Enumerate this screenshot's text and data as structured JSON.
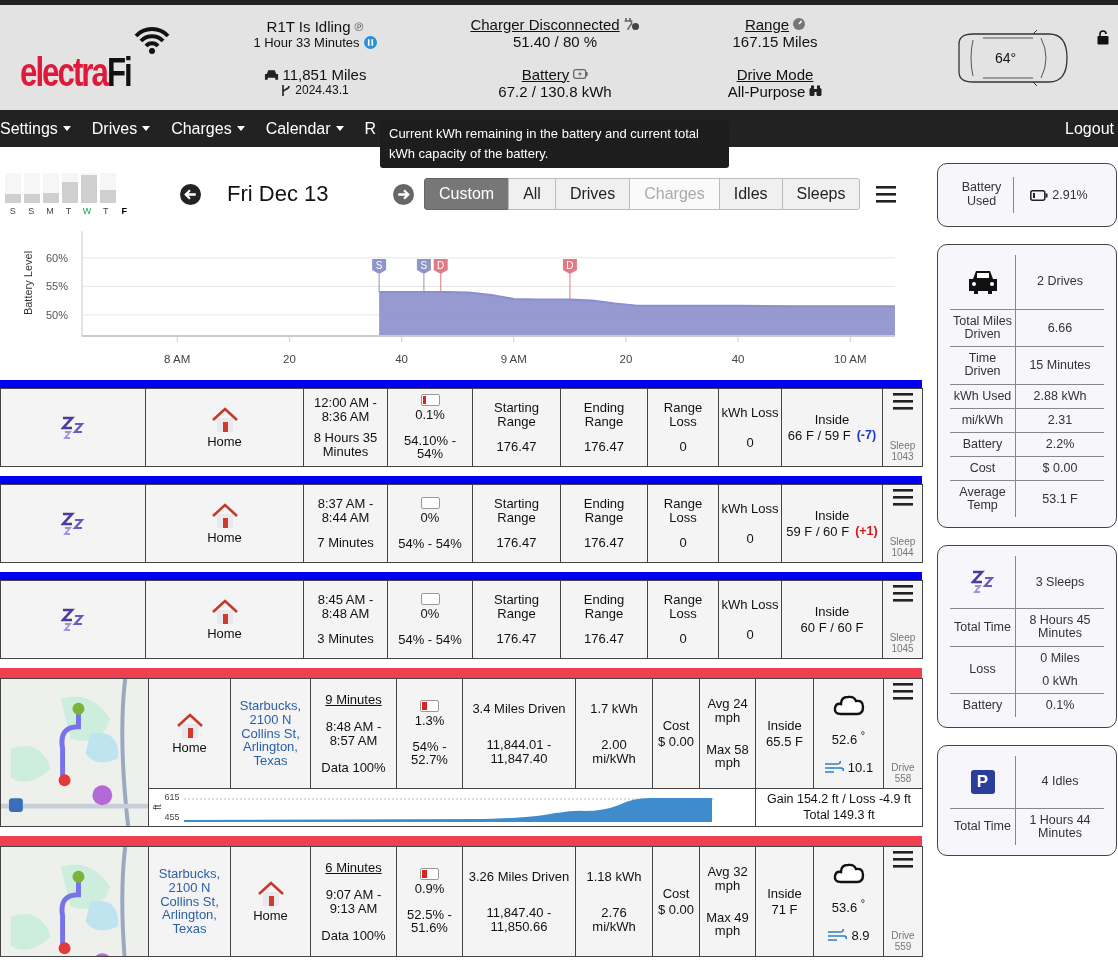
{
  "header": {
    "logo": {
      "main": "electra",
      "accent": "Fi"
    },
    "status": {
      "title": "R1T Is Idling",
      "badge": "℗",
      "duration": "1 Hour 33 Minutes"
    },
    "odometer": "11,851 Miles",
    "version": "2024.43.1",
    "charger": {
      "label": "Charger Disconnected",
      "value": "51.40 / 80 %"
    },
    "battery": {
      "label": "Battery",
      "value": "67.2 / 130.8 kWh"
    },
    "range": {
      "label": "Range",
      "value": "167.15 Miles"
    },
    "drive_mode": {
      "label": "Drive Mode",
      "value": "All-Purpose"
    },
    "cabin_temp": "64°",
    "locked": false
  },
  "nav": {
    "items": [
      "Settings",
      "Drives",
      "Charges",
      "Calendar",
      "R"
    ],
    "logout": "Logout"
  },
  "tooltip": "Current kWh remaining in the battery and current total kWh capacity of the battery.",
  "week": [
    {
      "day": "S",
      "level": 0.27,
      "kind": "past"
    },
    {
      "day": "S",
      "level": 0.3,
      "kind": "past"
    },
    {
      "day": "M",
      "level": 0.33,
      "kind": "past"
    },
    {
      "day": "T",
      "level": 0.67,
      "kind": "past"
    },
    {
      "day": "W",
      "level": 0.93,
      "kind": "highlight"
    },
    {
      "day": "T",
      "level": 0.43,
      "kind": "past"
    },
    {
      "day": "F",
      "kind": "today"
    }
  ],
  "date": "Fri Dec 13",
  "filters": [
    {
      "label": "Custom",
      "selected": true,
      "disabled": false
    },
    {
      "label": "All",
      "selected": false,
      "disabled": false
    },
    {
      "label": "Drives",
      "selected": false,
      "disabled": false
    },
    {
      "label": "Charges",
      "selected": false,
      "disabled": true
    },
    {
      "label": "Idles",
      "selected": false,
      "disabled": false
    },
    {
      "label": "Sleeps",
      "selected": false,
      "disabled": false
    }
  ],
  "chart_data": {
    "type": "area",
    "ylabel": "Battery Level",
    "grid": true,
    "xlim": [
      7.717,
      10.133
    ],
    "ylim": [
      46.3,
      64.7
    ],
    "xticks": [
      {
        "value": 8,
        "label": "8 AM"
      },
      {
        "value": 9,
        "label": "9 AM"
      },
      {
        "value": 10,
        "label": "10 AM"
      }
    ],
    "yticks": [
      {
        "value": 50,
        "label": "50%"
      },
      {
        "value": 55,
        "label": "55%"
      },
      {
        "value": 60,
        "label": "60%"
      }
    ],
    "x": [
      8.6,
      8.733,
      8.8,
      8.867,
      8.933,
      9.0,
      9.067,
      9.167,
      9.233,
      9.3,
      9.367,
      9.5,
      9.667,
      9.833,
      10.133
    ],
    "series": [
      {
        "color": "#8b8fcc",
        "values": [
          54,
          54,
          54,
          53.9,
          53.5,
          52.8,
          52.7,
          52.7,
          52.5,
          52.0,
          51.6,
          51.6,
          51.6,
          51.5,
          51.5
        ]
      }
    ],
    "annotations": [
      {
        "x": 8.6,
        "y": 54,
        "text": "S"
      },
      {
        "x": 8.733,
        "y": 54,
        "text": "S"
      },
      {
        "x": 8.783,
        "y": 54,
        "text": "D"
      },
      {
        "x": 9.167,
        "y": 52.7,
        "text": "D"
      }
    ]
  },
  "minor_xticks": [
    {
      "label": "20"
    },
    {
      "label": "40"
    },
    {
      "label": "20"
    },
    {
      "label": "40"
    }
  ],
  "chart_markers": [
    {
      "kind": "sleep"
    },
    {
      "kind": "sleep"
    },
    {
      "kind": "drive"
    },
    {
      "kind": "drive"
    }
  ],
  "rows": [
    {
      "kind": "sleep",
      "place": "Home",
      "time_range": "12:00 AM - 8:36 AM",
      "duration": "8 Hours 35 Minutes",
      "battery": {
        "used": "0.1%",
        "level": 0.25,
        "range": "54.10% - 54%"
      },
      "stats": [
        {
          "label": "Starting Range",
          "value": "176.47"
        },
        {
          "label": "Ending Range",
          "value": "176.47"
        },
        {
          "label": "Range Loss",
          "value": "0"
        },
        {
          "label": "kWh Loss",
          "value": "0"
        }
      ],
      "inside_label": "Inside",
      "inside": "66 F / 59 F",
      "delta": {
        "text": "(-7)",
        "color": "#1d3ac2"
      },
      "ref": "Sleep 1043"
    },
    {
      "kind": "sleep",
      "place": "Home",
      "time_range": "8:37 AM - 8:44 AM",
      "duration": "7 Minutes",
      "battery": {
        "used": "0%",
        "range": "54% - 54%"
      },
      "stats": [
        {
          "label": "Starting Range",
          "value": "176.47"
        },
        {
          "label": "Ending Range",
          "value": "176.47"
        },
        {
          "label": "Range Loss",
          "value": "0"
        },
        {
          "label": "kWh Loss",
          "value": "0"
        }
      ],
      "inside_label": "Inside",
      "inside": "59 F / 60 F",
      "delta": {
        "text": "(+1)",
        "color": "#d01818"
      },
      "ref": "Sleep 1044"
    },
    {
      "kind": "sleep",
      "place": "Home",
      "time_range": "8:45 AM - 8:48 AM",
      "duration": "3 Minutes",
      "battery": {
        "used": "0%",
        "range": "54% - 54%"
      },
      "stats": [
        {
          "label": "Starting Range",
          "value": "176.47"
        },
        {
          "label": "Ending Range",
          "value": "176.47"
        },
        {
          "label": "Range Loss",
          "value": "0"
        },
        {
          "label": "kWh Loss",
          "value": "0"
        }
      ],
      "inside_label": "Inside",
      "inside": "60 F / 60 F",
      "ref": "Sleep 1045"
    },
    {
      "kind": "drive",
      "places": [
        {
          "kind": "home",
          "label": "Home"
        },
        {
          "kind": "place",
          "label": "Starbucks, 2100 N Collins St, Arlington, Texas"
        }
      ],
      "duration": "9 Minutes",
      "time_range": "8:48 AM - 8:57 AM",
      "data_quality": "Data 100%",
      "battery": {
        "used": "1.3%",
        "level": 0.3,
        "range": "54% - 52.7%"
      },
      "distance": "3.4 Miles Driven",
      "odometer": "11,844.01 - 11,847.40",
      "energy": "1.7 kWh",
      "efficiency": "2.00 mi/kWh",
      "cost_label": "Cost",
      "cost": "$ 0.00",
      "avg_speed": "Avg 24 mph",
      "max_speed": "Max 58 mph",
      "inside_label": "Inside",
      "inside": "65.5 F",
      "temp": "52.6 $^{°}$",
      "wind": "10.1",
      "ref": "Drive 558",
      "elevation": {
        "unit": "ft",
        "max": "615",
        "min": "455",
        "gain_loss": "Gain 154.2 ft / Loss -4.9 ft",
        "total": "Total 149.3 ft"
      }
    },
    {
      "kind": "drive",
      "places": [
        {
          "kind": "place",
          "label": "Starbucks, 2100 N Collins St, Arlington, Texas"
        },
        {
          "kind": "home",
          "label": "Home"
        }
      ],
      "duration": "6 Minutes",
      "time_range": "9:07 AM - 9:13 AM",
      "data_quality": "Data 100%",
      "battery": {
        "used": "0.9%",
        "level": 0.3,
        "range": "52.5% - 51.6%"
      },
      "distance": "3.26 Miles Driven",
      "odometer": "11,847.40 - 11,850.66",
      "energy": "1.18 kWh",
      "efficiency": "2.76 mi/kWh",
      "cost_label": "Cost",
      "cost": "$ 0.00",
      "avg_speed": "Avg 32 mph",
      "max_speed": "Max 49 mph",
      "inside_label": "Inside",
      "inside": "71 F",
      "temp": "53.6 $^{°}$",
      "wind": "8.9",
      "ref": "Drive 559"
    }
  ],
  "sidebar": [
    {
      "kind": "battery",
      "label": "Battery Used",
      "value": "2.91%"
    },
    {
      "kind": "drives",
      "title": "2 Drives",
      "rows": [
        {
          "label": "Total Miles Driven",
          "values": [
            "6.66"
          ]
        },
        {
          "label": "Time Driven",
          "values": [
            "15 Minutes"
          ]
        },
        {
          "label": "kWh Used",
          "values": [
            "2.88 kWh"
          ]
        },
        {
          "label": "mi/kWh",
          "values": [
            "2.31"
          ]
        },
        {
          "label": "Battery",
          "values": [
            "2.2%"
          ]
        },
        {
          "label": "Cost",
          "values": [
            "$ 0.00"
          ]
        },
        {
          "label": "Average Temp",
          "values": [
            "53.1 F"
          ]
        }
      ]
    },
    {
      "kind": "sleeps",
      "title": "3 Sleeps",
      "rows": [
        {
          "label": "Total Time",
          "values": [
            "8 Hours 45 Minutes"
          ]
        },
        {
          "label": "Loss",
          "values": [
            "0 Miles",
            "0 kWh"
          ]
        },
        {
          "label": "Battery",
          "values": [
            "0.1%"
          ]
        }
      ]
    },
    {
      "kind": "idles",
      "icon_text": "P",
      "title": "4 Idles",
      "rows": [
        {
          "label": "Total Time",
          "values": [
            "1 Hours 44 Minutes"
          ]
        }
      ]
    }
  ]
}
